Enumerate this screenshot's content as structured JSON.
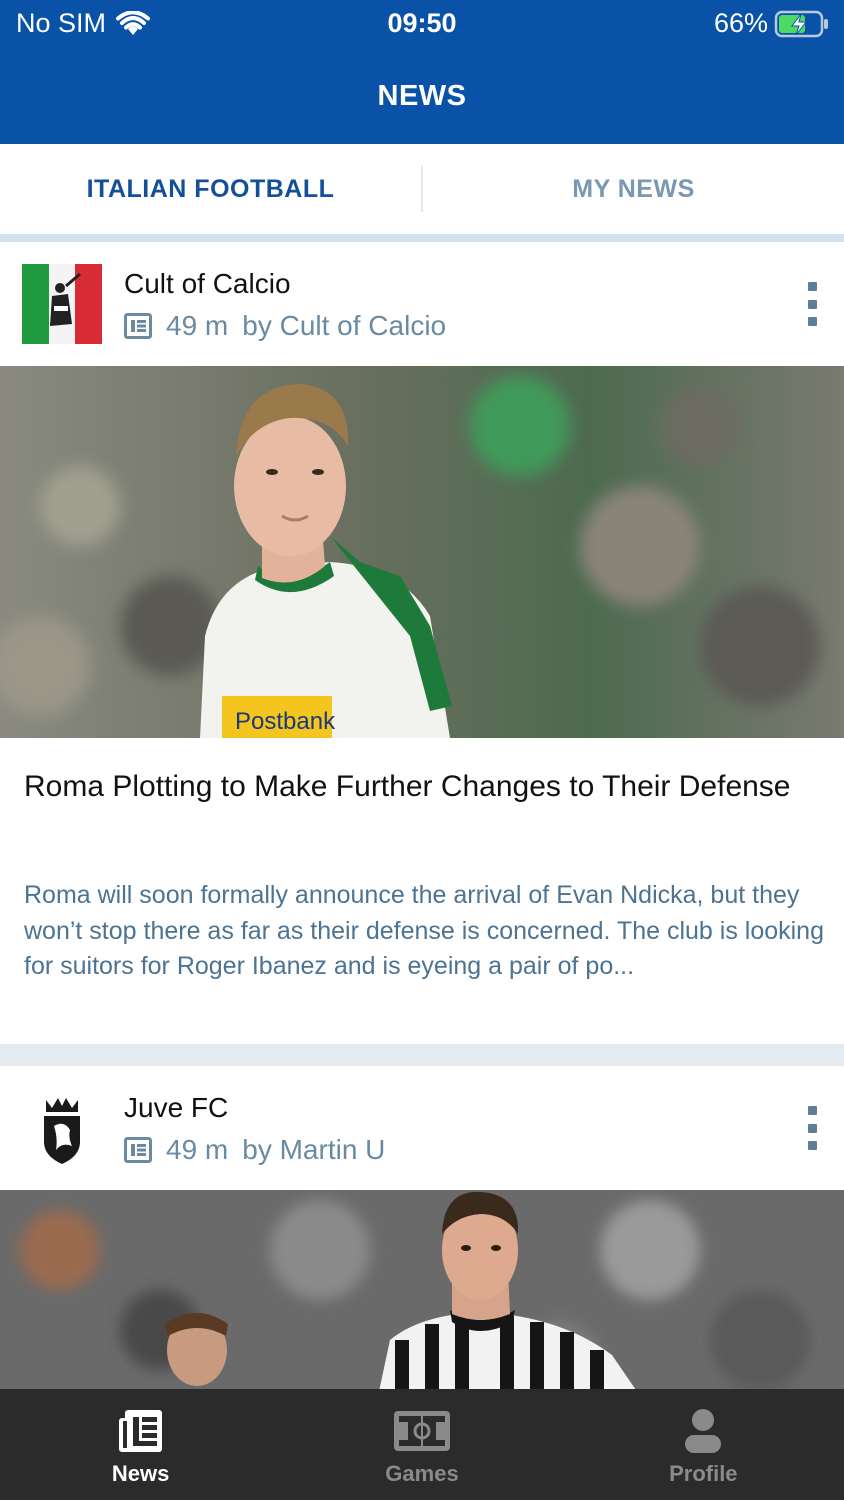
{
  "status_bar": {
    "carrier": "No SIM",
    "time": "09:50",
    "battery": "66%",
    "battery_level": 0.66
  },
  "header": {
    "title": "NEWS"
  },
  "tabs": [
    {
      "label": "ITALIAN FOOTBALL",
      "active": true
    },
    {
      "label": "MY NEWS",
      "active": false
    }
  ],
  "articles": [
    {
      "source": "Cult of Calcio",
      "age": "49 m",
      "byline": "by Cult of Calcio",
      "title": "Roma Plotting to Make Further Changes to Their Defense",
      "description": "Roma will soon formally announce the arrival of Evan Ndicka, but they won’t stop there as far as their defense is concerned. The club is looking for suitors for Roger Ibanez and is eyeing a pair of po...",
      "image_text": "Postbank"
    },
    {
      "source": "Juve FC",
      "age": "49 m",
      "byline": "by Martin U"
    }
  ],
  "bottom_nav": [
    {
      "label": "News",
      "icon": "news-icon",
      "active": true
    },
    {
      "label": "Games",
      "icon": "pitch-icon",
      "active": false
    },
    {
      "label": "Profile",
      "icon": "person-icon",
      "active": false
    }
  ],
  "colors": {
    "header": "#0a52a8",
    "active_tab": "#14509a",
    "inactive_tab": "#7a98b2",
    "meta_text": "#6a8aa2",
    "nav_bg": "#2b2b2b"
  }
}
